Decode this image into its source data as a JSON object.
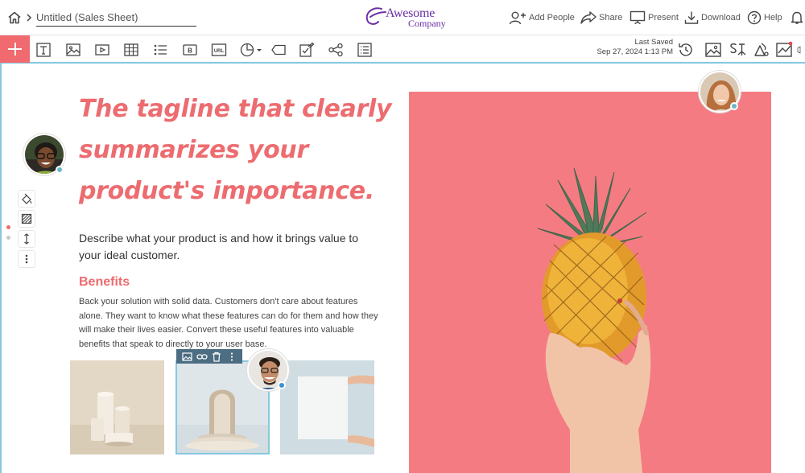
{
  "header": {
    "document_title": "Untitled (Sales Sheet)",
    "logo_line1": "Awesome",
    "logo_line2": "Company",
    "actions": {
      "add_people": "Add People",
      "share": "Share",
      "present": "Present",
      "download": "Download",
      "help": "Help"
    }
  },
  "toolbar": {
    "last_saved_label": "Last Saved",
    "last_saved_time": "Sep 27, 2024 1:13 PM",
    "tools": [
      "text-tool",
      "image-tool",
      "video-tool",
      "table-tool",
      "list-tool",
      "button-tool",
      "url-tool",
      "chart-tool",
      "shape-tool",
      "form-tool",
      "share-flow-tool",
      "layout-tool"
    ],
    "right_tools": [
      "history-icon",
      "image-library-icon",
      "style-icon",
      "color-palette-icon",
      "analytics-icon",
      "pages-icon"
    ]
  },
  "content": {
    "tagline": "The tagline that clearly summarizes your product's importance.",
    "description": "Describe what your product is and how it brings value to your ideal customer.",
    "benefits_heading": "Benefits",
    "benefits_text": "Back your solution with solid data. Customers don't care about features alone. They want to know what these features can do for them and how they will make their lives easier. Convert these useful features into valuable benefits that speak to directly to your user base."
  },
  "colors": {
    "accent": "#ec6c70",
    "add_button": "#f06a6f",
    "logo": "#6b2fa6",
    "selection": "#86c8de",
    "image_toolbar": "#4c6d82",
    "hero_background": "#f57b82"
  }
}
